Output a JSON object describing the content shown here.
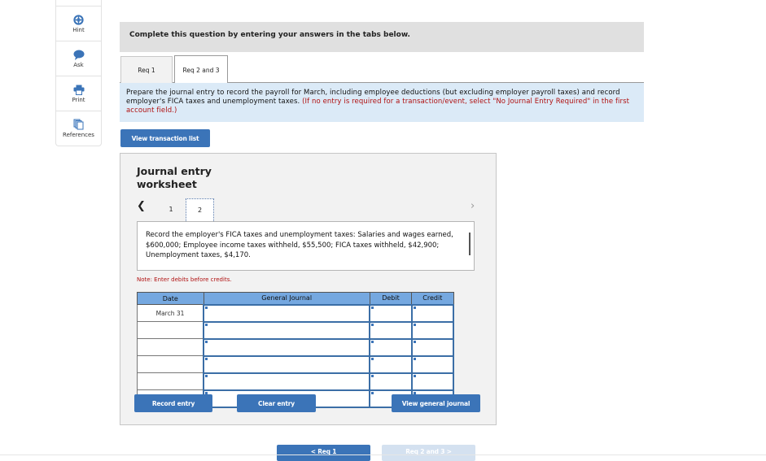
{
  "sidebar": {
    "items": [
      {
        "label": "",
        "icon": "blank"
      },
      {
        "label": "Hint",
        "icon": "lifebuoy-icon"
      },
      {
        "label": "Ask",
        "icon": "speech-bubble-icon"
      },
      {
        "label": "Print",
        "icon": "printer-icon"
      },
      {
        "label": "References",
        "icon": "documents-icon"
      }
    ]
  },
  "banner": {
    "text": "Complete this question by entering your answers in the tabs below."
  },
  "tabs": [
    {
      "label": "Req 1",
      "active": false
    },
    {
      "label": "Req 2 and 3",
      "active": true
    }
  ],
  "instructions": {
    "main": "Prepare the journal entry to record the payroll for March, including employee deductions (but excluding employer payroll taxes) and record employer's FICA taxes and unemployment taxes. ",
    "red": "(If no entry is required for a transaction/event, select \"No Journal Entry Required\" in the first account field.)"
  },
  "buttons": {
    "view_transaction_list": "View transaction list",
    "record_entry": "Record entry",
    "clear_entry": "Clear entry",
    "view_general_journal": "View general journal",
    "prev": "< Req 1",
    "next": "Req 2 and 3 >"
  },
  "worksheet": {
    "title_line1": "Journal entry",
    "title_line2": "worksheet",
    "pages": [
      "1",
      "2"
    ],
    "active_page": "2",
    "prev_glyph": "❮",
    "next_glyph": "›",
    "description": "Record the employer's FICA taxes and unemployment taxes: Salaries and wages earned, $600,000; Employee income taxes withheld, $55,500; FICA taxes withheld, $42,900; Unemployment taxes, $4,170.",
    "note": "Note: Enter debits before credits.",
    "table": {
      "headers": [
        "Date",
        "General Journal",
        "Debit",
        "Credit"
      ],
      "rows": [
        {
          "date": "March 31",
          "account": "",
          "debit": "",
          "credit": ""
        },
        {
          "date": "",
          "account": "",
          "debit": "",
          "credit": ""
        },
        {
          "date": "",
          "account": "",
          "debit": "",
          "credit": ""
        },
        {
          "date": "",
          "account": "",
          "debit": "",
          "credit": ""
        },
        {
          "date": "",
          "account": "",
          "debit": "",
          "credit": ""
        },
        {
          "date": "",
          "account": "",
          "debit": "",
          "credit": ""
        }
      ]
    }
  },
  "colors": {
    "button_blue": "#3b74b8",
    "header_blue": "#75a8e0",
    "instruction_bg": "#dbeaf7",
    "alert_red": "#b01010"
  }
}
